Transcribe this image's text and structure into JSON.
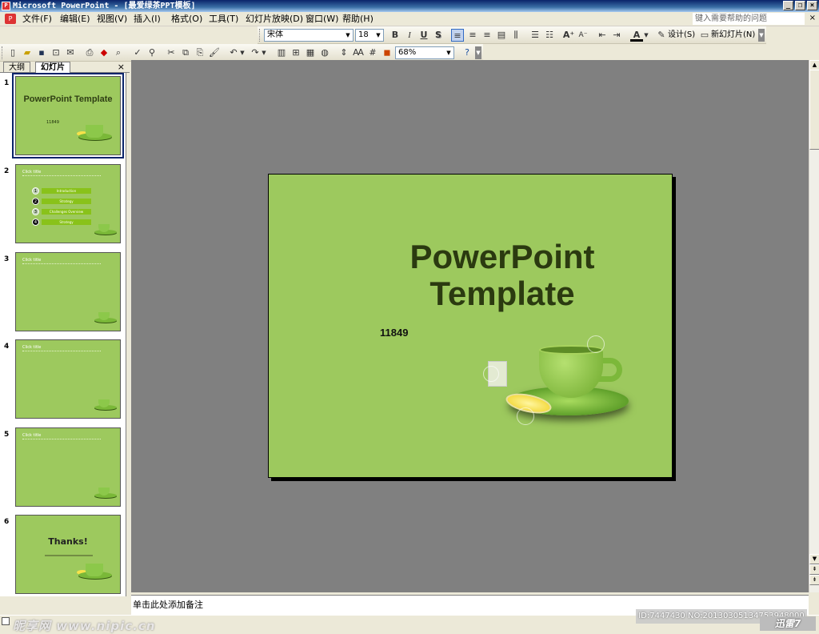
{
  "window": {
    "title": "Microsoft PowerPoint - [最爱绿茶PPT模板]",
    "controls": [
      "_",
      "❐",
      "×"
    ]
  },
  "menubar": {
    "items": [
      "文件(F)",
      "编辑(E)",
      "视图(V)",
      "插入(I)",
      "格式(O)",
      "工具(T)",
      "幻灯片放映(D)",
      "窗口(W)",
      "帮助(H)"
    ],
    "help_placeholder": "键入需要帮助的问题",
    "close": "×"
  },
  "formatting": {
    "font": "宋体",
    "size": "18",
    "bold": "B",
    "italic": "I",
    "underline": "U",
    "shadow": "S",
    "design_label": "设计(S)",
    "new_slide_label": "新幻灯片(N)"
  },
  "standard": {
    "zoom": "68%"
  },
  "tabs": {
    "outline": "大纲",
    "slides": "幻灯片",
    "close": "×"
  },
  "thumbnails": [
    {
      "num": "1",
      "title": "PowerPoint Template",
      "subnum": "11849"
    },
    {
      "num": "2",
      "header": "Click title",
      "items": [
        {
          "marker": "1",
          "text": "Introduction"
        },
        {
          "marker": "2",
          "text": "Strategy"
        },
        {
          "marker": "3",
          "text": "Challenges Overview"
        },
        {
          "marker": "4",
          "text": "Strategy"
        }
      ]
    },
    {
      "num": "3",
      "header": "Click title"
    },
    {
      "num": "4",
      "header": "Click title"
    },
    {
      "num": "5",
      "header": "Click title"
    },
    {
      "num": "6",
      "title": "Thanks!"
    }
  ],
  "slide": {
    "title_line1": "PowerPoint",
    "title_line2": "Template",
    "number": "11849"
  },
  "notes": {
    "placeholder": "单击此处添加备注"
  },
  "status": {
    "watermark": "昵享网 www.nipic.cn",
    "id_stamp": "ID:7447430 NO:20130305134753948000",
    "brand": "迅雷7"
  },
  "colors": {
    "slide_bg": "#9dc95e",
    "title_text": "#2b3a10",
    "editor_bg": "#808080"
  }
}
